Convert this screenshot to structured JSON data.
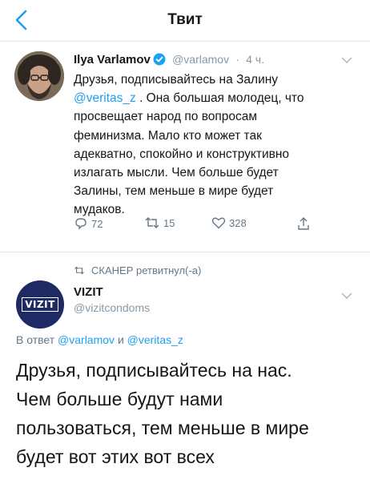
{
  "nav": {
    "title": "Твит"
  },
  "tweet": {
    "author_name": "Ilya Varlamov",
    "handle": "@varlamov",
    "separator": "·",
    "time": "4 ч.",
    "body_lines": [
      "Друзья, подписывайтесь на Залину",
      "@veritas_z",
      " . Она большая молодец, что",
      "просвещает народ по вопросам",
      "феминизма. Мало кто может так",
      "адекватно, спокойно и конструктивно",
      "излагать мысли. Чем больше будет",
      "Залины, тем меньше в мире будет",
      "мудаков."
    ],
    "reply_count": "72",
    "retweet_count": "15",
    "like_count": "328"
  },
  "retweet_note": "СКАНЕР ретвитнул(-а)",
  "reply": {
    "author_name": "VIZIT",
    "handle": "@vizitcondoms",
    "avatar_logo_text": "VIZIT",
    "reply_prefix": "В ответ",
    "reply_user1": "@varlamov",
    "reply_and": "и",
    "reply_user2": "@veritas_z",
    "body": "Друзья, подписывайтесь на нас.\nЧем больше будут нами\nпользоваться, тем меньше в мире\nбудет вот этих вот всех"
  },
  "colors": {
    "link": "#1da1f2",
    "muted": "#8899a6",
    "vizit_blue": "#1e2a63"
  }
}
